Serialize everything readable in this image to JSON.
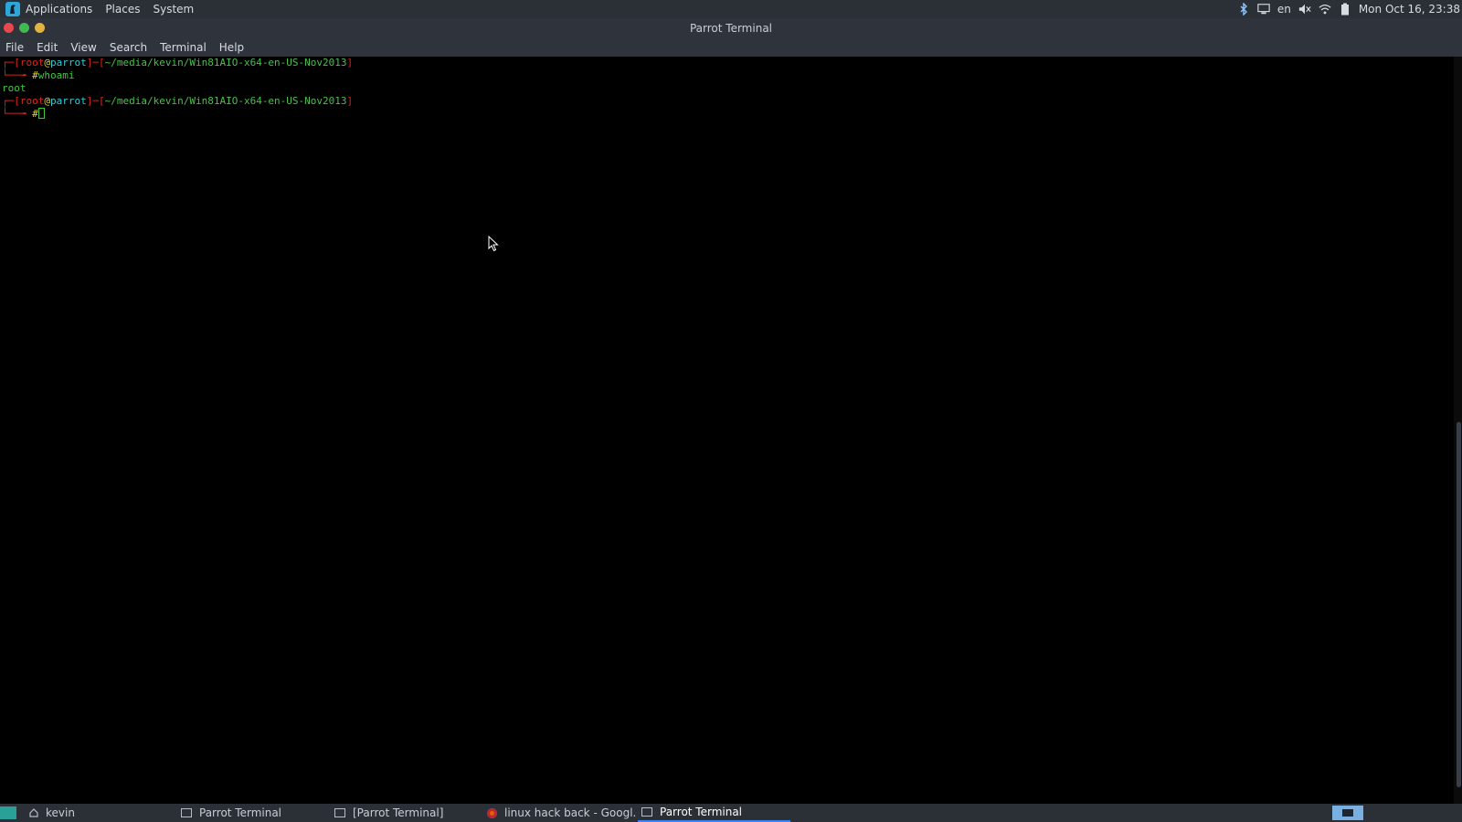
{
  "top_panel": {
    "menus": [
      "Applications",
      "Places",
      "System"
    ],
    "keyboard_layout": "en",
    "clock": "Mon Oct 16, 23:38"
  },
  "window": {
    "title": "Parrot Terminal",
    "menus": [
      "File",
      "Edit",
      "View",
      "Search",
      "Terminal",
      "Help"
    ]
  },
  "terminal": {
    "user": "root",
    "at": "@",
    "host": "parrot",
    "path": "/media/kevin/Win81AIO-x64-en-US-Nov2013",
    "tilde": "~",
    "prompt_symbol": "#",
    "command": "whoami",
    "output": "root"
  },
  "taskbar": {
    "items": [
      {
        "label": "kevin"
      },
      {
        "label": "Parrot Terminal"
      },
      {
        "label": "[Parrot Terminal]"
      },
      {
        "label": "linux hack back - Googl..."
      },
      {
        "label": "Parrot Terminal",
        "active": true
      }
    ]
  },
  "colors": {
    "panel_bg": "#2b2f36",
    "prompt_red": "#d7261e",
    "prompt_green": "#3cc93c",
    "accent_blue": "#3b82f6"
  }
}
